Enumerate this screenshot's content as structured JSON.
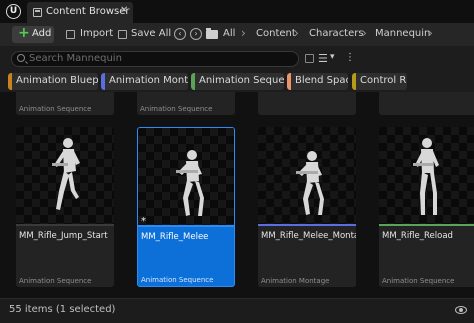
{
  "tab": {
    "title": "Content Browser",
    "close": "✕"
  },
  "logo": "U",
  "toolbar": {
    "add_label": "Add",
    "import_label": "Import",
    "save_all_label": "Save All",
    "breadcrumb": [
      "All",
      "Content",
      "Characters",
      "Mannequin"
    ]
  },
  "search": {
    "placeholder": "Search Mannequin"
  },
  "filters": [
    {
      "label": "Animation Blueprint",
      "color": "#c9831e"
    },
    {
      "label": "Animation Montage",
      "color": "#5b6de0"
    },
    {
      "label": "Animation Sequence",
      "color": "#5aa35a"
    },
    {
      "label": "Blend Space",
      "color": "#e8956b"
    },
    {
      "label": "Control Rig",
      "color": "#b59b1a"
    }
  ],
  "top_row": [
    {
      "type": "Animation Sequence"
    },
    {
      "type": "Animation Sequence"
    },
    {
      "type": ""
    },
    {
      "type": ""
    }
  ],
  "assets": [
    {
      "name": "MM_Rifle_Jump_Start",
      "type": "Animation Sequence",
      "strip_color": "#3a3a3a",
      "selected": false
    },
    {
      "name": "MM_Rifle_Melee",
      "type": "Animation Sequence",
      "strip_color": "#2b8cf5",
      "selected": true,
      "modified_mark": "*"
    },
    {
      "name": "MM_Rifle_Melee_Montage",
      "type": "Animation Montage",
      "strip_color": "#5b6de0",
      "selected": false
    },
    {
      "name": "MM_Rifle_Reload",
      "type": "Animation Sequence",
      "strip_color": "#5aa35a",
      "selected": false
    }
  ],
  "status": {
    "text": "55 items (1 selected)"
  },
  "colors": {
    "selection": "#0d6fd8",
    "add_plus": "#4fcf4f"
  }
}
